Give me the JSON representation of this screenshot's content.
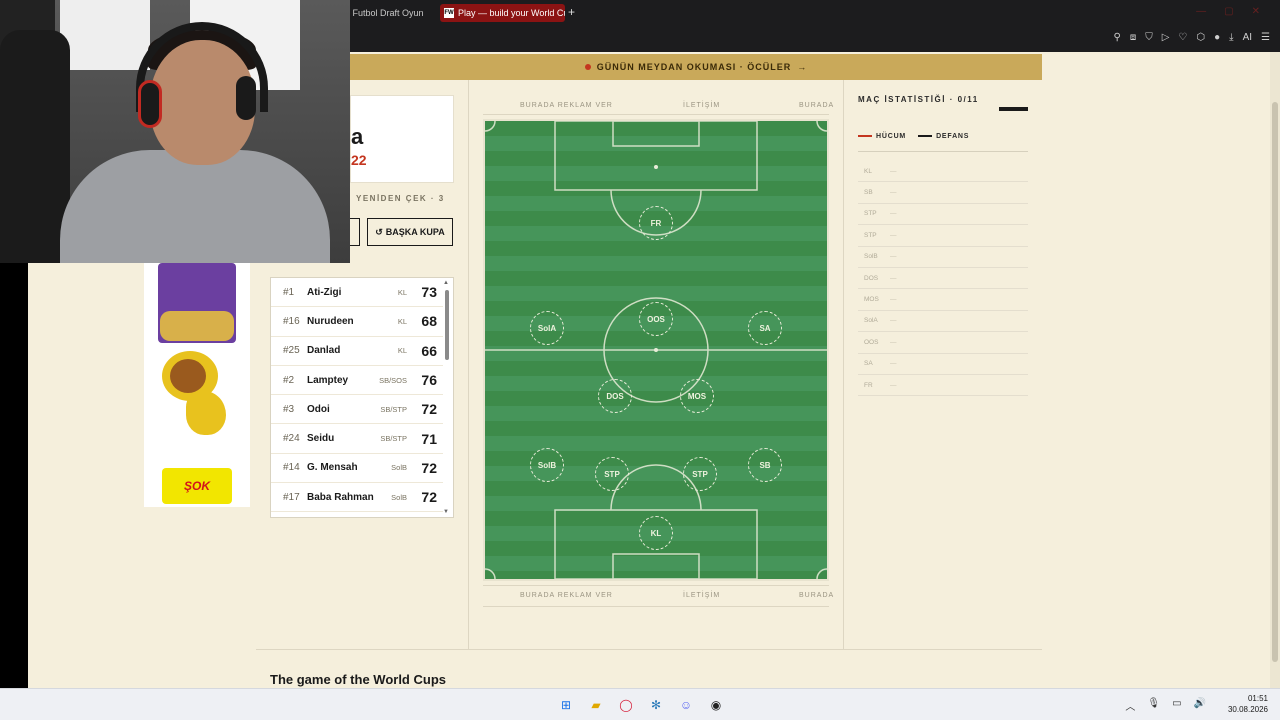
{
  "browser": {
    "tab_inactive_label": "an Futbol Draft Oyun",
    "tab_active_label": "Play — build your World Cu",
    "tab_active_favicon": "FW",
    "tab_close": "×",
    "new_tab": "+",
    "toolbar_ai_label": "AI"
  },
  "banner": {
    "text": "GÜNÜN MEYDAN OKUMASI · ÖCÜLER",
    "arrow": "→"
  },
  "pack": {
    "name_fragment": "a",
    "number_fragment": "22",
    "reroll_text": "YENİDEN ÇEK · 3",
    "other_cup_icon": "↺",
    "other_cup_label": "BAŞKA KUPA"
  },
  "players": [
    {
      "num": "#1",
      "name": "Ati-Zigi",
      "pos": "KL",
      "rating": "73"
    },
    {
      "num": "#16",
      "name": "Nurudeen",
      "pos": "KL",
      "rating": "68"
    },
    {
      "num": "#25",
      "name": "Danlad",
      "pos": "KL",
      "rating": "66"
    },
    {
      "num": "#2",
      "name": "Lamptey",
      "pos": "SB/SOS",
      "rating": "76"
    },
    {
      "num": "#3",
      "name": "Odoi",
      "pos": "SB/STP",
      "rating": "72"
    },
    {
      "num": "#24",
      "name": "Seidu",
      "pos": "SB/STP",
      "rating": "71"
    },
    {
      "num": "#14",
      "name": "G. Mensah",
      "pos": "SolB",
      "rating": "72"
    },
    {
      "num": "#17",
      "name": "Baba Rahman",
      "pos": "SolB",
      "rating": "72"
    }
  ],
  "ads": {
    "left": "BURADA REKLAM VER",
    "center": "İLETİŞİM",
    "right": "BURADA"
  },
  "pitch_slots": [
    {
      "label": "FR"
    },
    {
      "label": "SolA"
    },
    {
      "label": "OOS"
    },
    {
      "label": "SA"
    },
    {
      "label": "DOS"
    },
    {
      "label": "MOS"
    },
    {
      "label": "SolB"
    },
    {
      "label": "STP"
    },
    {
      "label": "STP"
    },
    {
      "label": "SB"
    },
    {
      "label": "KL"
    }
  ],
  "stats": {
    "title": "MAÇ İSTATİSTİĞİ · 0/11",
    "legend_attack": "HÜCUM",
    "legend_defense": "DEFANS",
    "attack_color": "#c4361f",
    "defense_color": "#1a1a1a",
    "rows": [
      {
        "label": "KL",
        "value": "—"
      },
      {
        "label": "SB",
        "value": "—"
      },
      {
        "label": "STP",
        "value": "—"
      },
      {
        "label": "STP",
        "value": "—"
      },
      {
        "label": "SolB",
        "value": "—"
      },
      {
        "label": "DOS",
        "value": "—"
      },
      {
        "label": "MOS",
        "value": "—"
      },
      {
        "label": "SolA",
        "value": "—"
      },
      {
        "label": "OOS",
        "value": "—"
      },
      {
        "label": "SA",
        "value": "—"
      },
      {
        "label": "FR",
        "value": "—"
      }
    ]
  },
  "footer": {
    "title": "The game of the World Cups"
  },
  "ad_sok_text": "ŞOK",
  "taskbar": {
    "time": "01:51",
    "date": "30.08.2026"
  }
}
